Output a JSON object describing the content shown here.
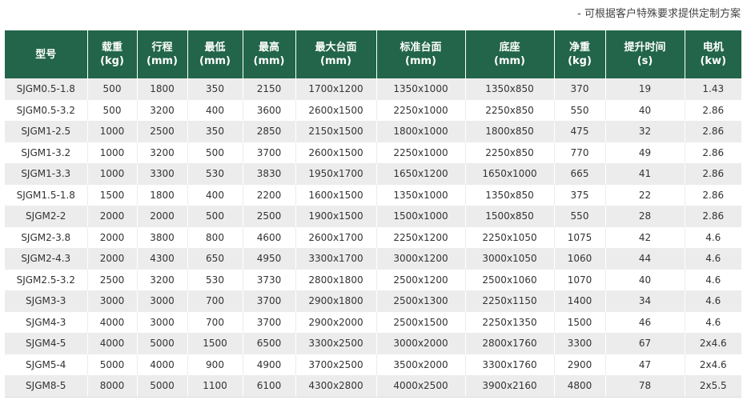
{
  "note": "- 可根据客户特殊要求提供定制方案",
  "table": {
    "headers": [
      {
        "label": "型号",
        "unit": ""
      },
      {
        "label": "载重",
        "unit": "(kg)"
      },
      {
        "label": "行程",
        "unit": "(mm)"
      },
      {
        "label": "最低",
        "unit": "(mm)"
      },
      {
        "label": "最高",
        "unit": "(mm)"
      },
      {
        "label": "最大台面",
        "unit": "(mm)"
      },
      {
        "label": "标准台面",
        "unit": "(mm)"
      },
      {
        "label": "底座",
        "unit": "(mm)"
      },
      {
        "label": "净重",
        "unit": "(kg)"
      },
      {
        "label": "提升时间",
        "unit": "(s)"
      },
      {
        "label": "电机",
        "unit": "(kw)"
      }
    ],
    "rows": [
      [
        "SJGM0.5-1.8",
        "500",
        "1800",
        "350",
        "2150",
        "1700x1200",
        "1350x1000",
        "1350x850",
        "370",
        "19",
        "1.43"
      ],
      [
        "SJGM0.5-3.2",
        "500",
        "3200",
        "400",
        "3600",
        "2600x1500",
        "2250x1000",
        "2250x850",
        "550",
        "40",
        "2.86"
      ],
      [
        "SJGM1-2.5",
        "1000",
        "2500",
        "350",
        "2850",
        "2150x1500",
        "1800x1000",
        "1800x850",
        "475",
        "32",
        "2.86"
      ],
      [
        "SJGM1-3.2",
        "1000",
        "3200",
        "500",
        "3700",
        "2600x1500",
        "2250x1000",
        "2250x850",
        "770",
        "49",
        "2.86"
      ],
      [
        "SJGM1-3.3",
        "1000",
        "3300",
        "530",
        "3830",
        "1950x1700",
        "1650x1200",
        "1650x1000",
        "665",
        "41",
        "2.86"
      ],
      [
        "SJGM1.5-1.8",
        "1500",
        "1800",
        "400",
        "2200",
        "1600x1500",
        "1350x1000",
        "1350x850",
        "375",
        "22",
        "2.86"
      ],
      [
        "SJGM2-2",
        "2000",
        "2000",
        "500",
        "2500",
        "1900x1500",
        "1500x1000",
        "1500x850",
        "550",
        "28",
        "2.86"
      ],
      [
        "SJGM2-3.8",
        "2000",
        "3800",
        "800",
        "4600",
        "2600x1700",
        "2250x1200",
        "2250x1050",
        "1075",
        "42",
        "4.6"
      ],
      [
        "SJGM2-4.3",
        "2000",
        "4300",
        "650",
        "4950",
        "3300x1700",
        "3000x1200",
        "3000x1050",
        "1060",
        "44",
        "4.6"
      ],
      [
        "SJGM2.5-3.2",
        "2500",
        "3200",
        "530",
        "3730",
        "2800x1800",
        "2500x1200",
        "2500x1060",
        "1070",
        "40",
        "4.6"
      ],
      [
        "SJGM3-3",
        "3000",
        "3000",
        "700",
        "3700",
        "2900x1800",
        "2500x1300",
        "2250x1150",
        "1400",
        "34",
        "4.6"
      ],
      [
        "SJGM4-3",
        "4000",
        "3000",
        "700",
        "3700",
        "2900x2000",
        "2500x1500",
        "2250x1350",
        "1500",
        "46",
        "4.6"
      ],
      [
        "SJGM4-5",
        "4000",
        "5000",
        "1500",
        "6500",
        "3300x2500",
        "3000x2000",
        "2800x1760",
        "3300",
        "67",
        "2x4.6"
      ],
      [
        "SJGM5-4",
        "5000",
        "4000",
        "900",
        "4900",
        "3700x2500",
        "3500x2000",
        "3300x1760",
        "2900",
        "47",
        "2x4.6"
      ],
      [
        "SJGM8-5",
        "8000",
        "5000",
        "1100",
        "6100",
        "4300x2800",
        "4000x2500",
        "3900x2160",
        "4800",
        "78",
        "2x5.5"
      ]
    ]
  },
  "colors": {
    "header_bg": "#22654a",
    "header_text": "#ffffff",
    "row_alt_bg": "#ececec",
    "text": "#333333"
  }
}
